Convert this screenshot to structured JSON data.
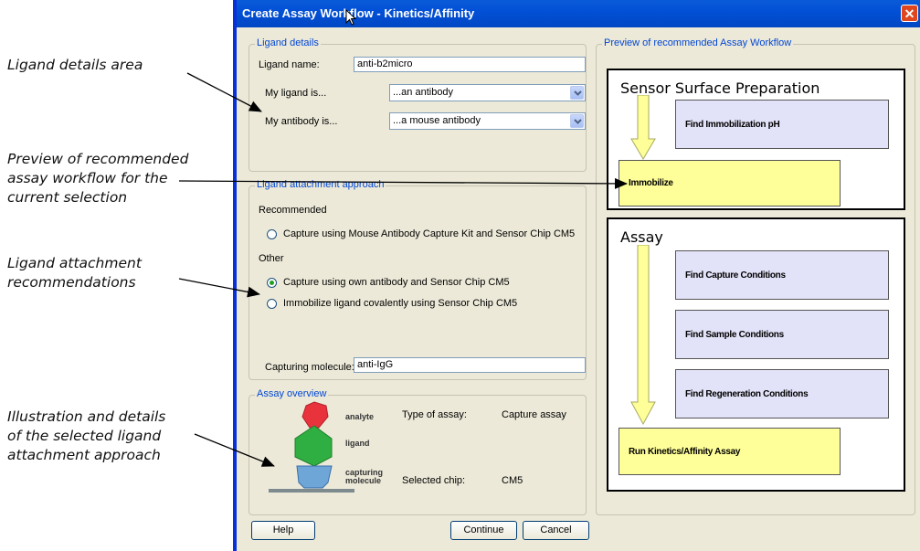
{
  "callouts": {
    "ligand_details": "Ligand details area",
    "preview": [
      "Preview of recommended",
      "assay workflow for the",
      "current selection"
    ],
    "attachment": [
      "Ligand attachment",
      "recommendations"
    ],
    "illustration": [
      "Illustration and details",
      "of the selected ligand",
      "attachment approach"
    ]
  },
  "window": {
    "title": "Create Assay Workflow - Kinetics/Affinity",
    "close_glyph": "✕"
  },
  "ligand_details": {
    "group_title": "Ligand details",
    "name_label": "Ligand name:",
    "name_value": "anti-b2micro",
    "ligand_is_label": "My ligand is...",
    "ligand_is_value": "...an antibody",
    "antibody_is_label": "My antibody is...",
    "antibody_is_value": "...a mouse antibody"
  },
  "attachment": {
    "group_title": "Ligand attachment approach",
    "recommended_label": "Recommended",
    "option_recommended": "Capture using Mouse Antibody Capture Kit and Sensor Chip CM5",
    "other_label": "Other",
    "option_own": "Capture using own antibody and Sensor Chip CM5",
    "option_covalent": "Immobilize ligand covalently using Sensor Chip CM5",
    "selected_option": "option_own",
    "capturing_label": "Capturing molecule:",
    "capturing_value": "anti-IgG"
  },
  "overview": {
    "group_title": "Assay overview",
    "analyte": "analyte",
    "ligand": "ligand",
    "capturing": "capturing",
    "molecule": "molecule",
    "type_label": "Type of assay:",
    "type_value": "Capture assay",
    "chip_label": "Selected chip:",
    "chip_value": "CM5"
  },
  "preview": {
    "group_title": "Preview of recommended Assay Workflow",
    "sensor_heading": "Sensor Surface Preparation",
    "find_ph": "Find Immobilization pH",
    "immobilize": "Immobilize",
    "assay_heading": "Assay",
    "find_capture": "Find Capture Conditions",
    "find_sample": "Find Sample Conditions",
    "find_regeneration": "Find Regeneration Conditions",
    "run_kinetics": "Run Kinetics/Affinity Assay"
  },
  "buttons": {
    "help": "Help",
    "continue": "Continue",
    "cancel": "Cancel"
  },
  "colors": {
    "titlebar": "#0250d6",
    "group_title": "#0046d5",
    "step_blue": "#e2e2f8",
    "step_yellow": "#ffff99"
  }
}
